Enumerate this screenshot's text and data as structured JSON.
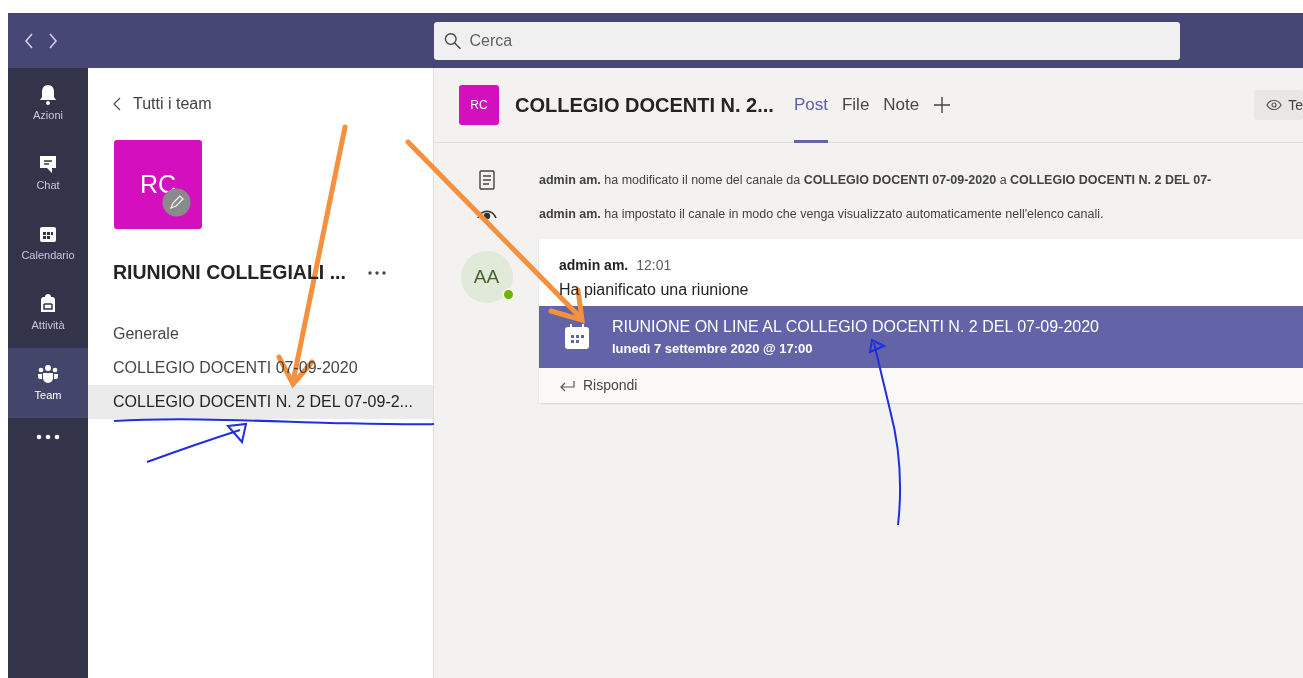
{
  "search": {
    "placeholder": "Cerca"
  },
  "rail": {
    "items": [
      {
        "kind": "bell",
        "label": "Azioni",
        "selected": false
      },
      {
        "kind": "chat",
        "label": "Chat",
        "selected": false
      },
      {
        "kind": "calendar",
        "label": "Calendario",
        "selected": false
      },
      {
        "kind": "backpack",
        "label": "Attività",
        "selected": false
      },
      {
        "kind": "team",
        "label": "Team",
        "selected": true
      }
    ]
  },
  "team_panel": {
    "back_link": "Tutti i team",
    "avatar": "RC",
    "name": "RIUNIONI COLLEGIALI ...",
    "channels": [
      {
        "name": "Generale",
        "selected": false
      },
      {
        "name": "COLLEGIO DOCENTI 07-09-2020",
        "selected": false
      },
      {
        "name": "COLLEGIO DOCENTI N. 2 DEL 07-09-2...",
        "selected": true
      }
    ]
  },
  "channel_header": {
    "avatar": "RC",
    "title": "COLLEGIO DOCENTI N. 2...",
    "tabs": [
      {
        "label": "Post",
        "selected": true
      },
      {
        "label": "File",
        "selected": false
      },
      {
        "label": "Note",
        "selected": false
      }
    ],
    "team_button": "Te"
  },
  "activity": [
    {
      "kind": "rename",
      "text": "**admin am.** ha modificato il nome del canale da **COLLEGIO DOCENTI 07-09-2020** a **COLLEGIO DOCENTI N. 2 DEL 07-**"
    },
    {
      "kind": "visibility",
      "text": "**admin am.** ha impostato il canale in modo che venga visualizzato automaticamente nell'elenco canali."
    }
  ],
  "post": {
    "avatar": "AA",
    "online": true,
    "author": "admin am.",
    "time": "12:01",
    "text": "Ha pianificato una riunione",
    "meeting": {
      "title": "RIUNIONE ON LINE AL COLLEGIO DOCENTI N. 2 DEL 07-09-2020",
      "when": "lunedì 7 settembre 2020 @ 17:00"
    },
    "reply": "Rispondi"
  }
}
